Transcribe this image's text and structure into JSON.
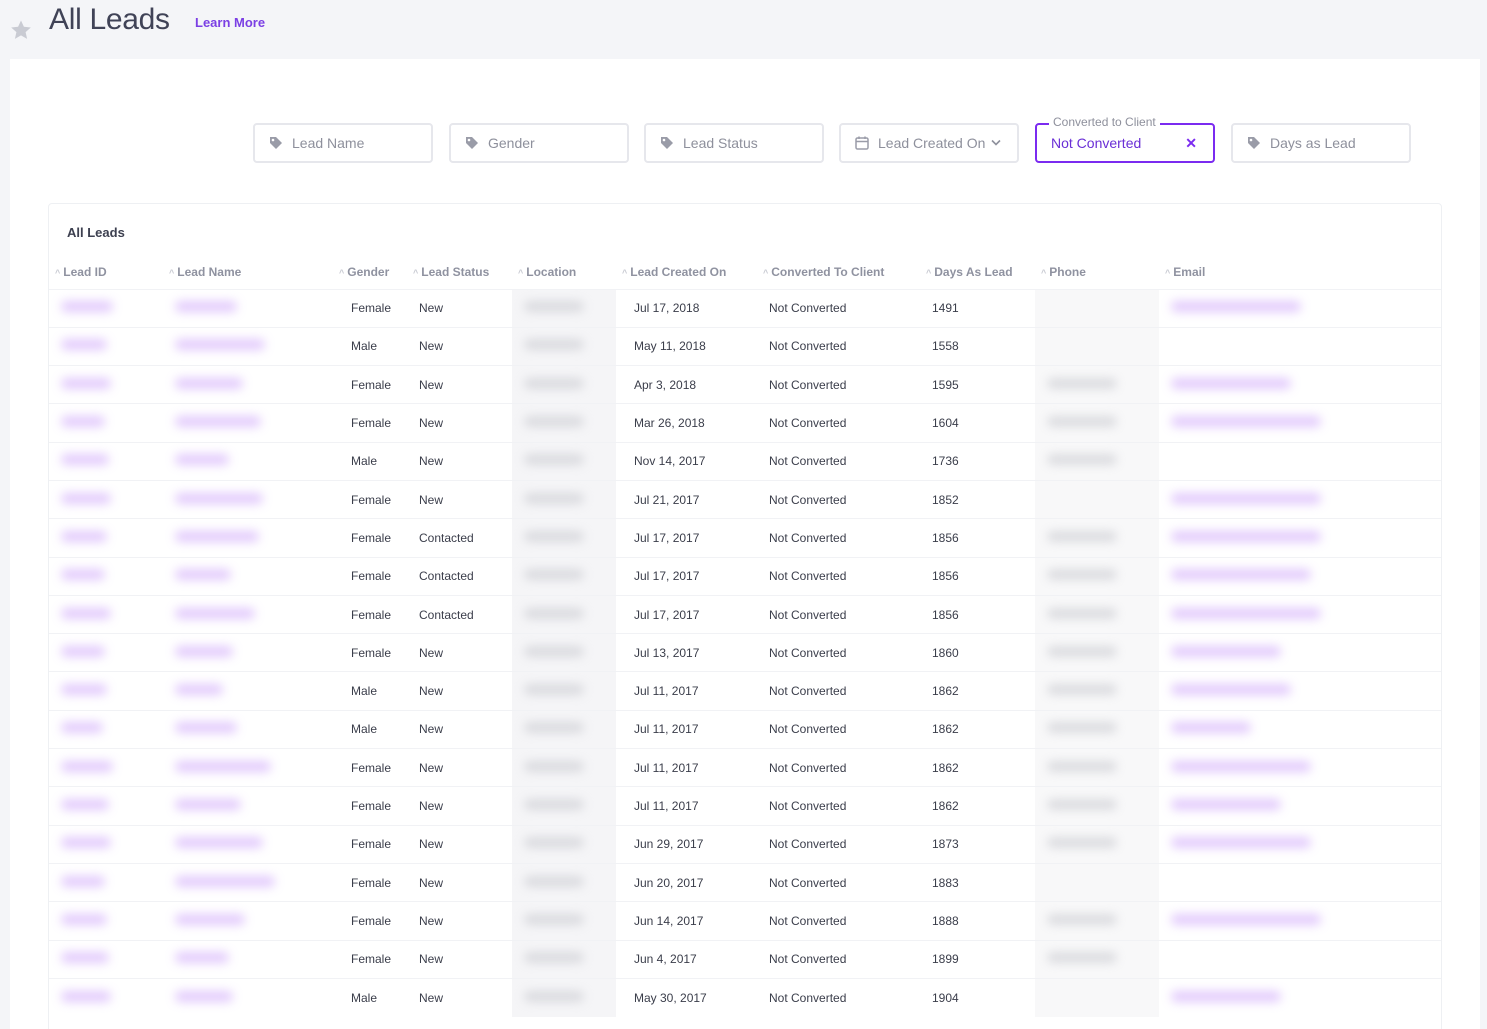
{
  "header": {
    "title": "All Leads",
    "learn_more": "Learn More"
  },
  "filters": {
    "lead_name": "Lead Name",
    "gender": "Gender",
    "lead_status": "Lead Status",
    "lead_created_on": "Lead Created On",
    "converted_legend": "Converted to Client",
    "converted_value": "Not Converted",
    "converted_clear": "✕",
    "days_as_lead": "Days as Lead"
  },
  "table": {
    "title": "All Leads",
    "columns": {
      "lead_id": "Lead ID",
      "lead_name": "Lead Name",
      "gender": "Gender",
      "lead_status": "Lead Status",
      "location": "Location",
      "lead_created_on": "Lead Created On",
      "converted": "Converted To Client",
      "days": "Days As Lead",
      "phone": "Phone",
      "email": "Email"
    },
    "rows": [
      {
        "gender": "Female",
        "status": "New",
        "created": "Jul 17, 2018",
        "converted": "Not Converted",
        "days": "1491"
      },
      {
        "gender": "Male",
        "status": "New",
        "created": "May 11, 2018",
        "converted": "Not Converted",
        "days": "1558"
      },
      {
        "gender": "Female",
        "status": "New",
        "created": "Apr 3, 2018",
        "converted": "Not Converted",
        "days": "1595"
      },
      {
        "gender": "Female",
        "status": "New",
        "created": "Mar 26, 2018",
        "converted": "Not Converted",
        "days": "1604"
      },
      {
        "gender": "Male",
        "status": "New",
        "created": "Nov 14, 2017",
        "converted": "Not Converted",
        "days": "1736"
      },
      {
        "gender": "Female",
        "status": "New",
        "created": "Jul 21, 2017",
        "converted": "Not Converted",
        "days": "1852"
      },
      {
        "gender": "Female",
        "status": "Contacted",
        "created": "Jul 17, 2017",
        "converted": "Not Converted",
        "days": "1856"
      },
      {
        "gender": "Female",
        "status": "Contacted",
        "created": "Jul 17, 2017",
        "converted": "Not Converted",
        "days": "1856"
      },
      {
        "gender": "Female",
        "status": "Contacted",
        "created": "Jul 17, 2017",
        "converted": "Not Converted",
        "days": "1856"
      },
      {
        "gender": "Female",
        "status": "New",
        "created": "Jul 13, 2017",
        "converted": "Not Converted",
        "days": "1860"
      },
      {
        "gender": "Male",
        "status": "New",
        "created": "Jul 11, 2017",
        "converted": "Not Converted",
        "days": "1862"
      },
      {
        "gender": "Male",
        "status": "New",
        "created": "Jul 11, 2017",
        "converted": "Not Converted",
        "days": "1862"
      },
      {
        "gender": "Female",
        "status": "New",
        "created": "Jul 11, 2017",
        "converted": "Not Converted",
        "days": "1862"
      },
      {
        "gender": "Female",
        "status": "New",
        "created": "Jul 11, 2017",
        "converted": "Not Converted",
        "days": "1862"
      },
      {
        "gender": "Female",
        "status": "New",
        "created": "Jun 29, 2017",
        "converted": "Not Converted",
        "days": "1873"
      },
      {
        "gender": "Female",
        "status": "New",
        "created": "Jun 20, 2017",
        "converted": "Not Converted",
        "days": "1883"
      },
      {
        "gender": "Female",
        "status": "New",
        "created": "Jun 14, 2017",
        "converted": "Not Converted",
        "days": "1888"
      },
      {
        "gender": "Female",
        "status": "New",
        "created": "Jun 4, 2017",
        "converted": "Not Converted",
        "days": "1899"
      },
      {
        "gender": "Male",
        "status": "New",
        "created": "May 30, 2017",
        "converted": "Not Converted",
        "days": "1904"
      }
    ]
  },
  "colors": {
    "accent": "#7b2bf0",
    "link": "#7b3fe4",
    "background": "#f4f5f8"
  }
}
